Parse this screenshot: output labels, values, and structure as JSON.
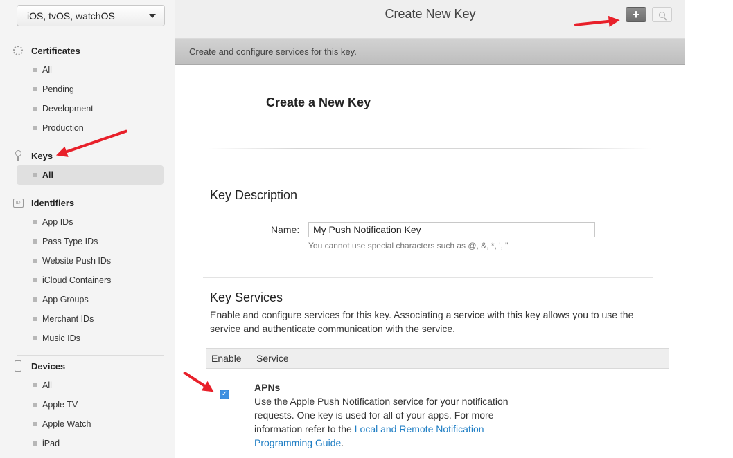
{
  "sidebar": {
    "platform": "iOS, tvOS, watchOS",
    "certificates": {
      "title": "Certificates",
      "icon": "certificate-icon",
      "items": [
        "All",
        "Pending",
        "Development",
        "Production"
      ]
    },
    "keys": {
      "title": "Keys",
      "icon": "key-icon",
      "items": [
        "All"
      ],
      "active": "All"
    },
    "identifiers": {
      "title": "Identifiers",
      "icon": "id-icon",
      "icon_text": "ID",
      "items": [
        "App IDs",
        "Pass Type IDs",
        "Website Push IDs",
        "iCloud Containers",
        "App Groups",
        "Merchant IDs",
        "Music IDs"
      ]
    },
    "devices": {
      "title": "Devices",
      "icon": "device-icon",
      "items": [
        "All",
        "Apple TV",
        "Apple Watch",
        "iPad"
      ]
    }
  },
  "header": {
    "title": "Create New Key",
    "add_icon": "plus-icon",
    "add_symbol": "+",
    "search_icon": "search-icon"
  },
  "subheader": {
    "text": "Create and configure services for this key."
  },
  "main": {
    "title": "Create a New Key",
    "key_description": {
      "heading": "Key Description",
      "name_label": "Name:",
      "name_value": "My Push Notification Key",
      "hint": "You cannot use special characters such as @, &, *, ', \""
    },
    "key_services": {
      "heading": "Key Services",
      "description": "Enable and configure services for this key. Associating a service with this key allows you to use the service and authenticate communication with the service.",
      "columns": [
        "Enable",
        "Service"
      ],
      "services": [
        {
          "name": "APNs",
          "enabled": true,
          "check_symbol": "✓",
          "description_pre": "Use the Apple Push Notification service for your notification requests. One key is used for all of your apps. For more information refer to the ",
          "link_text": "Local and Remote Notification Programming Guide",
          "description_post": "."
        }
      ]
    }
  },
  "colors": {
    "accent_link": "#1f7ec4",
    "checkbox": "#3d8fe0",
    "annotation_arrow": "#e8202a"
  }
}
